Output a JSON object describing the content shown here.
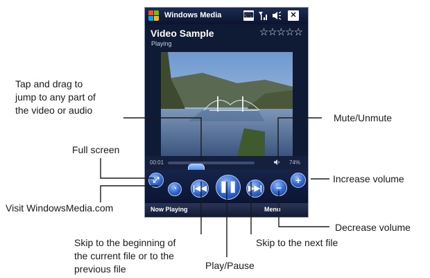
{
  "phone": {
    "app_title": "Windows Media",
    "titlebar_icons": [
      "keyboard-icon",
      "signal-icon",
      "volume-icon",
      "close-icon"
    ],
    "media_title": "Video Sample",
    "media_status": "Playing",
    "rating_stars": "☆☆☆☆☆",
    "time_elapsed": "00:01",
    "volume_level": "74%",
    "progress": 0.33,
    "volume": 0.74,
    "softkey_left": "Now Playing",
    "softkey_right": "Menu"
  },
  "callouts": {
    "seek_line1": "Tap and drag to",
    "seek_line2": "jump to any part of",
    "seek_line3": "the video or audio",
    "full_screen": "Full screen",
    "visit_site": "Visit WindowsMedia.com",
    "skip_begin_line1": "Skip to the beginning of",
    "skip_begin_line2": "the current file or to the",
    "skip_begin_line3": "previous file",
    "play_pause": "Play/Pause",
    "skip_next": "Skip to the next file",
    "mute": "Mute/Unmute",
    "increase_volume": "Increase volume",
    "decrease_volume": "Decrease volume"
  },
  "colors": {
    "screen_bg": "#0f1a35",
    "button_blue": "#2f63c8",
    "annotation_text": "#1a1a1a"
  }
}
